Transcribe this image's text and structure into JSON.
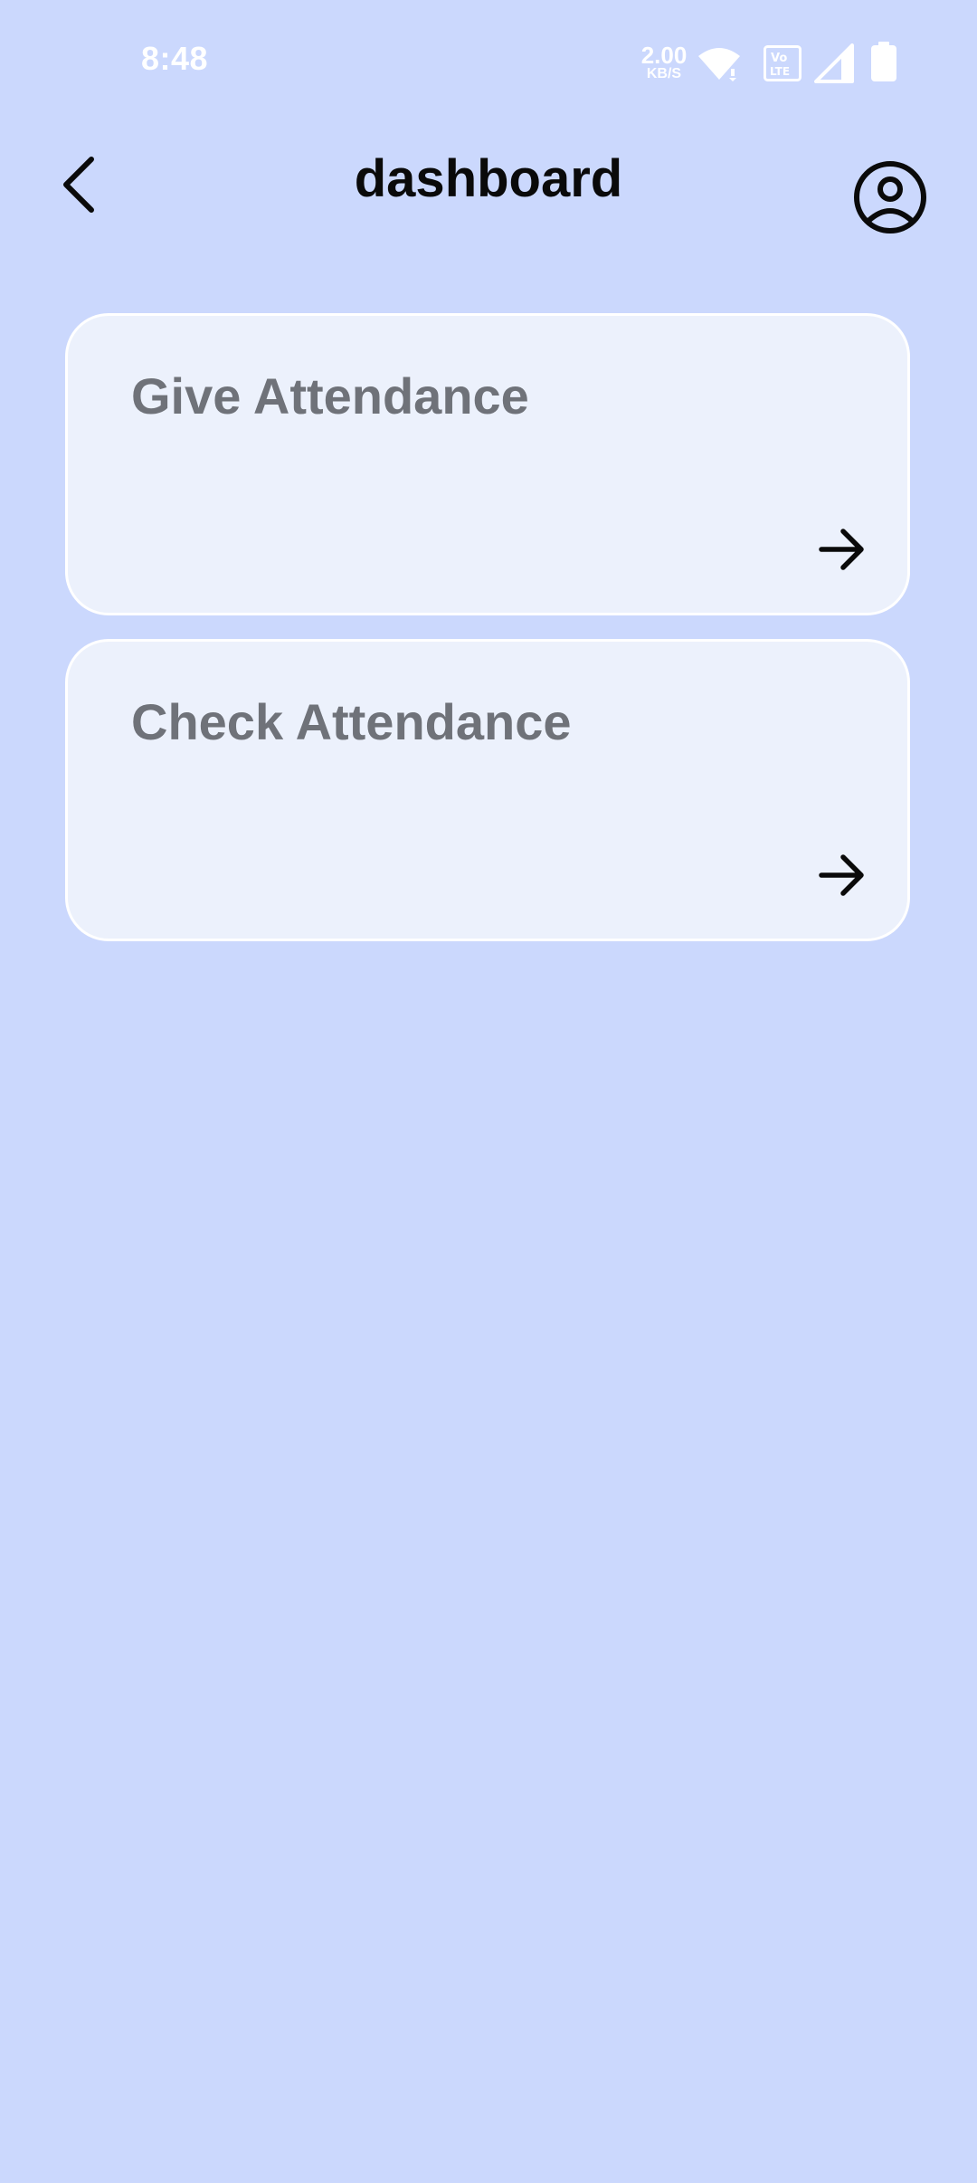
{
  "status_bar": {
    "time": "8:48",
    "network_speed_value": "2.00",
    "network_speed_unit": "KB/S",
    "icons": [
      "wifi-icon",
      "volte-icon",
      "signal-icon",
      "battery-icon"
    ]
  },
  "header": {
    "title": "dashboard",
    "back_icon": "chevron-left-icon",
    "profile_icon": "user-circle-icon"
  },
  "cards": [
    {
      "label": "Give Attendance",
      "icon": "arrow-right-icon"
    },
    {
      "label": "Check Attendance",
      "icon": "arrow-right-icon"
    }
  ],
  "colors": {
    "background": "#cbd8fd",
    "card_background": "#ecf1fc",
    "card_border": "#ffffff",
    "card_text": "#6f7279",
    "title_text": "#0a0a0a",
    "status_text": "#ffffff"
  }
}
